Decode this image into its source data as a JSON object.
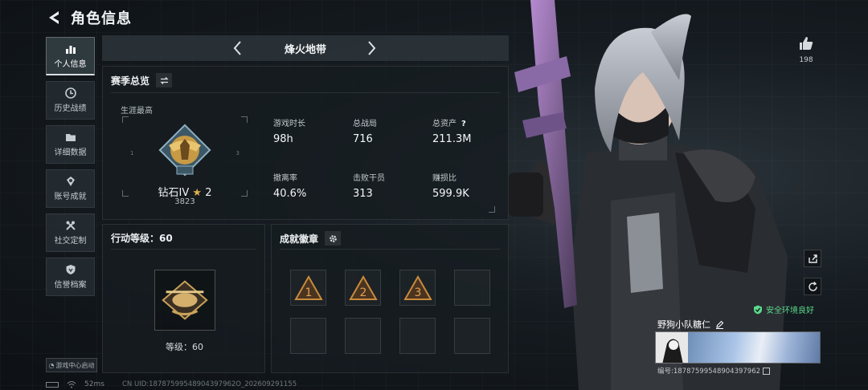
{
  "header": {
    "title": "角色信息"
  },
  "nav": {
    "items": [
      {
        "label": "个人信息",
        "icon": "bar-chart-icon",
        "active": true
      },
      {
        "label": "历史战绩",
        "icon": "clock-icon",
        "active": false
      },
      {
        "label": "详细数据",
        "icon": "folder-icon",
        "active": false
      },
      {
        "label": "账号成就",
        "icon": "medal-icon",
        "active": false
      },
      {
        "label": "社交定制",
        "icon": "tools-icon",
        "active": false
      },
      {
        "label": "信誉档案",
        "icon": "shield-icon",
        "active": false
      }
    ],
    "launch_badge": "游戏中心启动"
  },
  "mode": {
    "name": "烽火地带"
  },
  "season": {
    "title": "赛季总览",
    "career_label": "生涯最高",
    "rank": {
      "name": "钻石IV",
      "star_count": "2",
      "score": "3823"
    },
    "stats": [
      {
        "label": "游戏时长",
        "value": "98h"
      },
      {
        "label": "总战局",
        "value": "716"
      },
      {
        "label": "总资产",
        "value": "211.3M",
        "help": "?"
      },
      {
        "label": "撤离率",
        "value": "40.6%"
      },
      {
        "label": "击败干员",
        "value": "313"
      },
      {
        "label": "赚损比",
        "value": "599.9K"
      }
    ]
  },
  "level": {
    "title": "行动等级：60",
    "caption": "等级：60"
  },
  "badges": {
    "title": "成就徽章",
    "slots": [
      "badge-tier-1",
      "badge-tier-2",
      "badge-tier-3",
      "",
      "",
      "",
      "",
      ""
    ]
  },
  "profile": {
    "likes": "198",
    "safety": "安全环境良好",
    "player_name": "野狗小队糖仁",
    "player_id": "编号:18787599548904397962"
  },
  "status": {
    "ping": "52ms",
    "uid": "CN UID:18787599548904397962O_202609291155"
  },
  "colors": {
    "accent_green": "#5bd98c",
    "gold": "#e0b04a"
  }
}
